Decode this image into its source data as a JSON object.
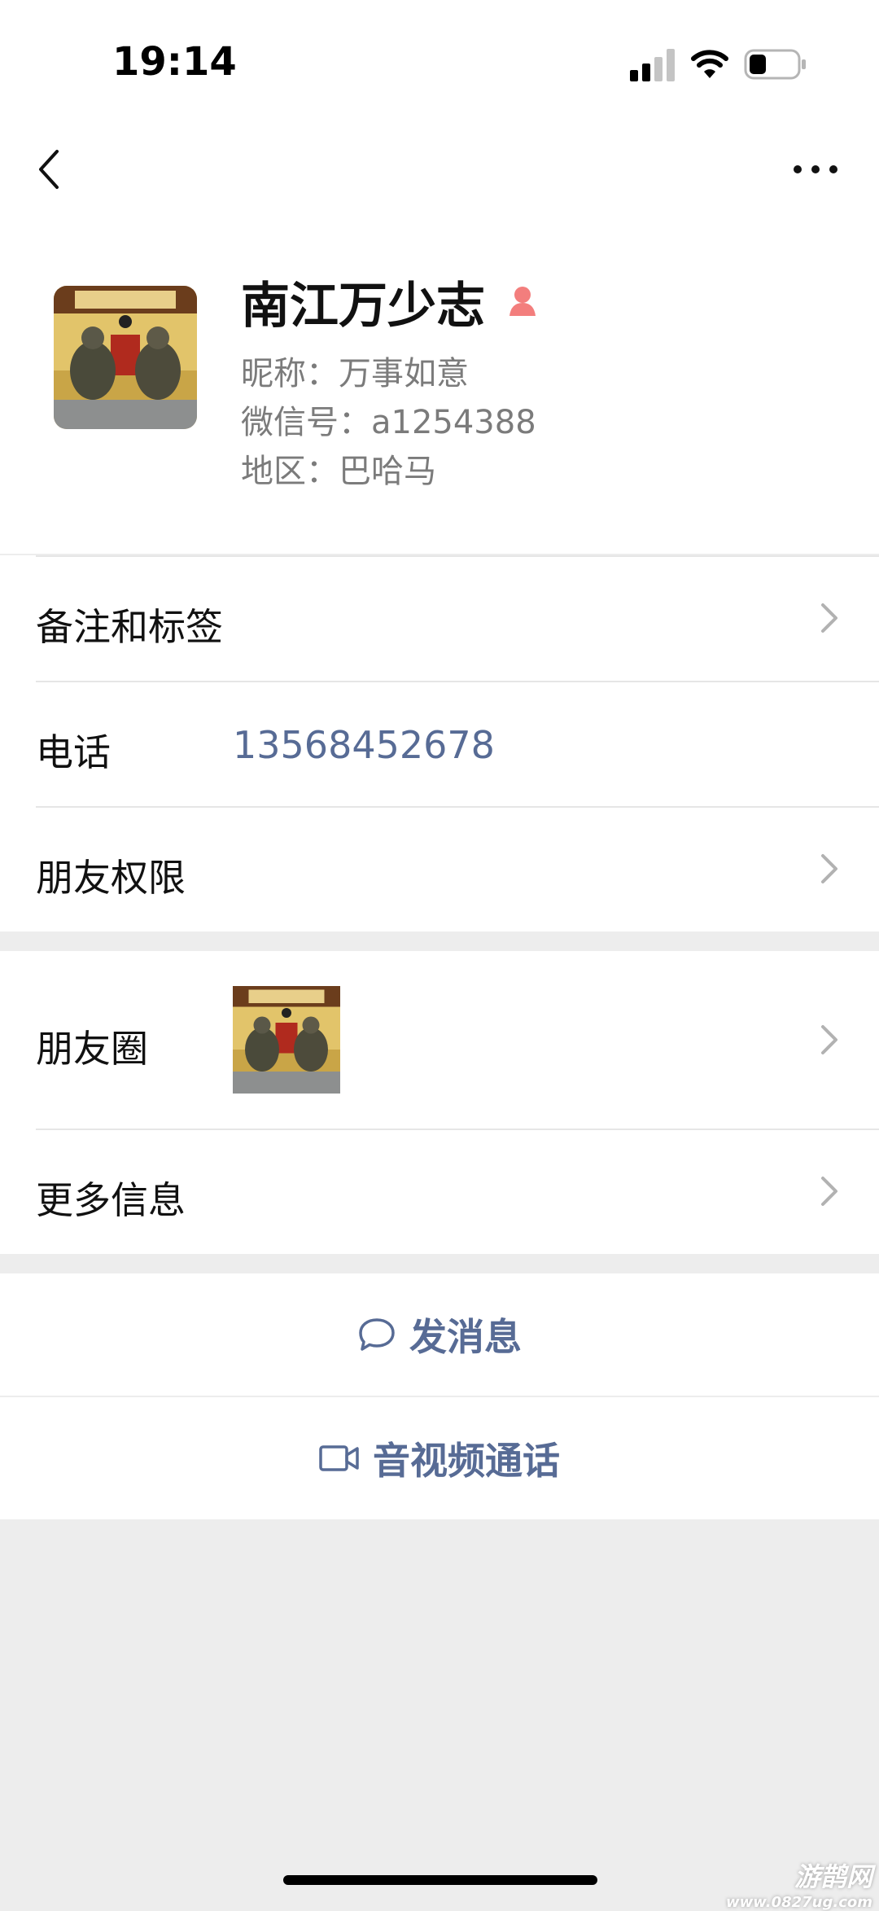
{
  "status_bar": {
    "time": "19:14"
  },
  "profile": {
    "name": "南江万少志",
    "nickname": "昵称：万事如意",
    "wechat_id": "微信号：a1254388",
    "region": "地区：巴哈马"
  },
  "cells": {
    "remarks_tags": "备注和标签",
    "phone_label": "电话",
    "phone_number": "13568452678",
    "friend_permissions": "朋友权限",
    "moments": "朋友圈",
    "more_info": "更多信息"
  },
  "actions": {
    "send_message": "发消息",
    "av_call": "音视频通话"
  },
  "watermark": {
    "line1": "游鹊网",
    "line2": "www.0827ug.com"
  },
  "colors": {
    "link": "#576b95",
    "background": "#ededed",
    "gender_female": "#f37e7d"
  },
  "icons": [
    "back-arrow-icon",
    "more-icon",
    "female-icon",
    "chevron-right-icon",
    "chat-bubble-icon",
    "video-camera-icon"
  ]
}
